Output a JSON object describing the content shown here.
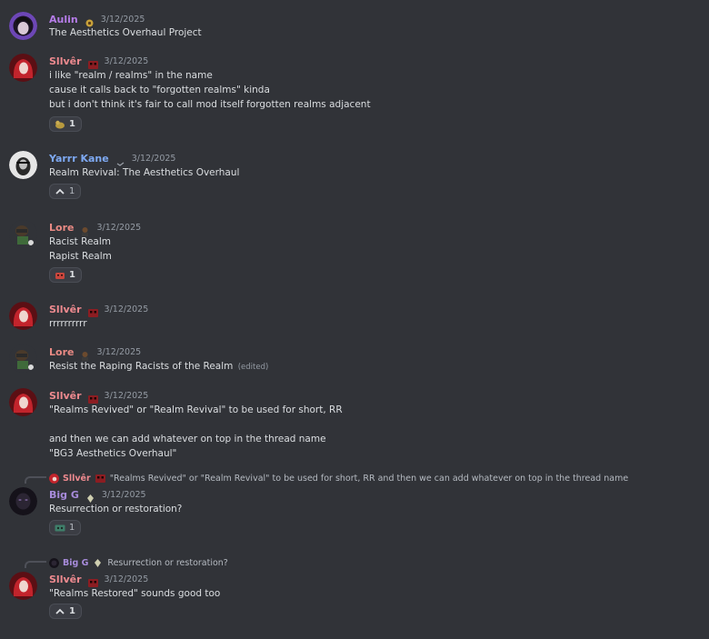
{
  "colors": {
    "background": "#313338",
    "aulin": "#b57ce8",
    "silver": "#ee8a8f",
    "yarrr": "#7ea9f2",
    "lore": "#e98a84",
    "big_g": "#a78bda",
    "timestamp": "#949ba4"
  },
  "messages": [
    {
      "author": "Aulin",
      "timestamp": "3/12/2025",
      "lines": [
        "The Aesthetics Overhaul Project"
      ]
    },
    {
      "author": "Sllvêr",
      "timestamp": "3/12/2025",
      "lines": [
        "i like \"realm / realms\" in the name",
        "cause it calls back to \"forgotten realms\" kinda",
        "but i don't think it's fair to call mod itself forgotten realms adjacent"
      ],
      "reaction": {
        "icon": "duck-emoji",
        "count": "1"
      }
    },
    {
      "author": "Yarrr Kane",
      "timestamp": "3/12/2025",
      "lines": [
        "Realm Revival: The Aesthetics Overhaul"
      ],
      "reaction": {
        "icon": "caret-up-emoji",
        "count": "1"
      }
    },
    {
      "author": "Lore",
      "timestamp": "3/12/2025",
      "lines": [
        "Racist Realm",
        "Rapist Realm"
      ],
      "reaction": {
        "icon": "red-mask-emoji",
        "count": "1"
      }
    },
    {
      "author": "Sllvêr",
      "timestamp": "3/12/2025",
      "lines": [
        "rrrrrrrrrr"
      ]
    },
    {
      "author": "Lore",
      "timestamp": "3/12/2025",
      "lines": [
        "Resist the Raping Racists of the Realm"
      ],
      "edited": "(edited)"
    },
    {
      "author": "Sllvêr",
      "timestamp": "3/12/2025",
      "lines": [
        "\"Realms Revived\" or \"Realm Revival\" to be used for short, RR",
        "",
        "and then we can add whatever on top in the thread name",
        "\"BG3 Aesthetics Overhaul\""
      ]
    },
    {
      "reply_to": {
        "author": "Sllvêr",
        "text": "\"Realms Revived\" or \"Realm Revival\" to be used for short, RR and then we can add whatever on top in the thread name"
      },
      "author": "Big G",
      "timestamp": "3/12/2025",
      "lines": [
        "Resurrection or restoration?"
      ],
      "reaction": {
        "icon": "cassette-emoji",
        "count": "1"
      }
    },
    {
      "reply_to": {
        "author": "Big G",
        "text": "Resurrection or restoration?"
      },
      "author": "Sllvêr",
      "timestamp": "3/12/2025",
      "lines": [
        "\"Realms Restored\" sounds good too"
      ],
      "reaction": {
        "icon": "caret-up-emoji",
        "count": "1"
      }
    }
  ]
}
